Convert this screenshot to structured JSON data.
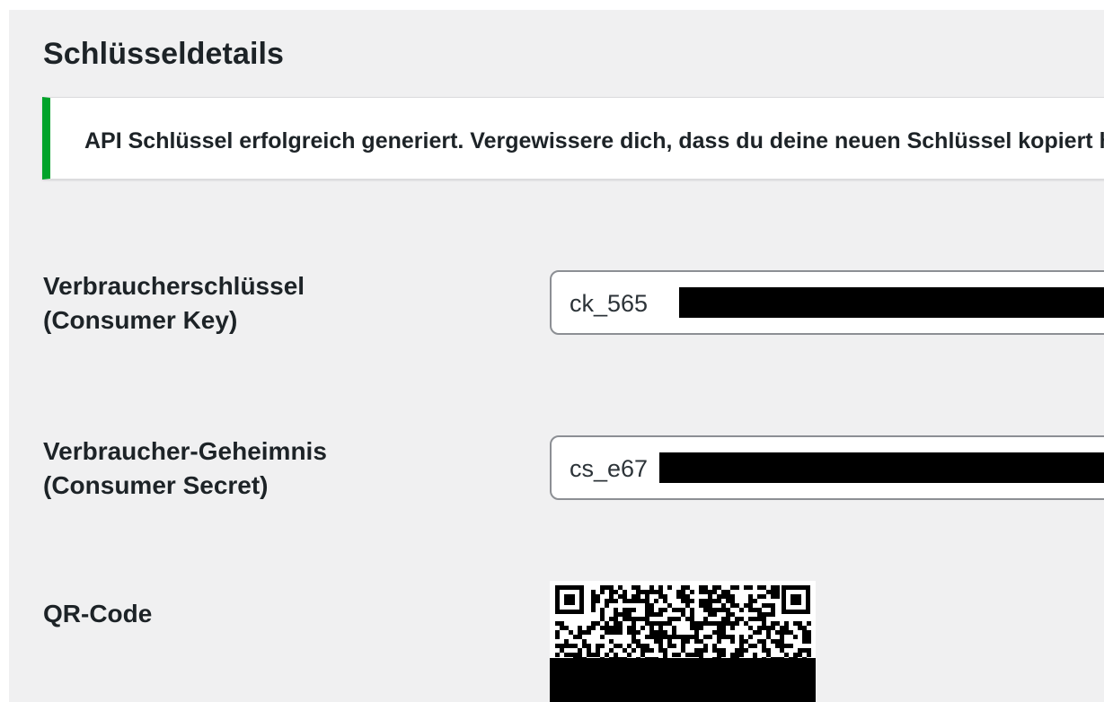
{
  "page": {
    "title": "Schlüsseldetails"
  },
  "notice": {
    "text": "API Schlüssel erfolgreich generiert. Vergewissere dich, dass du deine neuen Schlüssel kopiert hast."
  },
  "consumer_key": {
    "label_line1": "Verbraucherschlüssel",
    "label_line2": "(Consumer Key)",
    "value": "ck_565"
  },
  "consumer_secret": {
    "label_line1": "Verbraucher-Geheimnis",
    "label_line2": "(Consumer Secret)",
    "value": "cs_e67"
  },
  "qr": {
    "label": "QR-Code"
  },
  "colors": {
    "panel_bg": "#f0f0f1",
    "notice_success": "#00a32a",
    "text": "#1d2327"
  }
}
